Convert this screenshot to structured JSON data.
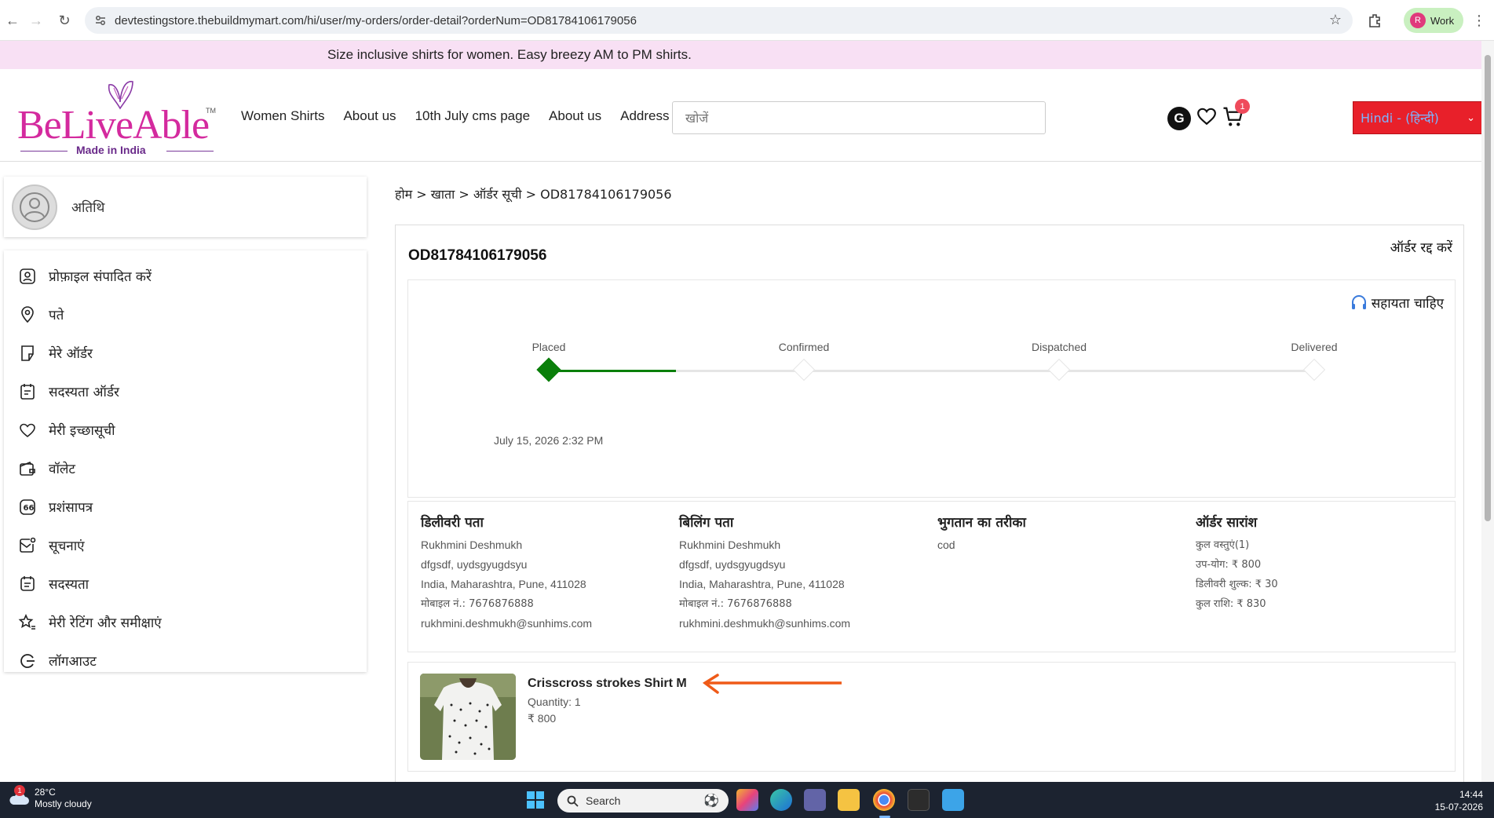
{
  "browser": {
    "url": "devtestingstore.thebuildmymart.com/hi/user/my-orders/order-detail?orderNum=OD81784106179056",
    "profile_initial": "R",
    "profile_label": "Work"
  },
  "promo": {
    "text": "Size inclusive shirts for women. Easy breezy AM to PM shirts."
  },
  "header": {
    "logo_word": "BeLiveAble",
    "logo_tm": "TM",
    "logo_tagline": "Made in India",
    "nav": [
      "Women Shirts",
      "About us",
      "10th July cms page",
      "About us",
      "Address"
    ],
    "search_placeholder": "खोजें",
    "account_initial": "G",
    "cart_count": "1",
    "language": "Hindi - (हिन्दी)"
  },
  "sidebar": {
    "user_name": "अतिथि",
    "items": [
      {
        "label": "प्रोफ़ाइल संपादित करें",
        "icon": "user-icon"
      },
      {
        "label": "पते",
        "icon": "location-pin-icon"
      },
      {
        "label": "मेरे ऑर्डर",
        "icon": "orders-icon"
      },
      {
        "label": "सदस्यता ऑर्डर",
        "icon": "subscription-order-icon"
      },
      {
        "label": "मेरी इच्छासूची",
        "icon": "heart-icon"
      },
      {
        "label": "वॉलेट",
        "icon": "wallet-icon"
      },
      {
        "label": "प्रशंसापत्र",
        "icon": "quote-icon"
      },
      {
        "label": "सूचनाएं",
        "icon": "notification-icon"
      },
      {
        "label": "सदस्यता",
        "icon": "membership-icon"
      },
      {
        "label": "मेरी रेटिंग और समीक्षाएं",
        "icon": "star-review-icon"
      },
      {
        "label": "लॉगआउट",
        "icon": "logout-icon"
      }
    ]
  },
  "breadcrumb": "होम > खाता > ऑर्डर सूची > OD81784106179056",
  "order": {
    "id": "OD81784106179056",
    "cancel_label": "ऑर्डर रद्द करें",
    "help_label": "सहायता चाहिए",
    "steps": [
      "Placed",
      "Confirmed",
      "Dispatched",
      "Delivered"
    ],
    "completed_steps": 1,
    "placed_date": "July 15, 2026 2:32 PM",
    "delivery": {
      "title": "डिलीवरी पता",
      "name": "Rukhmini Deshmukh",
      "line1": "dfgsdf, uydsgyugdsyu",
      "line2": "India, Maharashtra, Pune, 411028",
      "mobile": "मोबाइल नं.: 7676876888",
      "email": "rukhmini.deshmukh@sunhims.com"
    },
    "billing": {
      "title": "बिलिंग पता",
      "name": "Rukhmini Deshmukh",
      "line1": "dfgsdf, uydsgyugdsyu",
      "line2": "India, Maharashtra, Pune, 411028",
      "mobile": "मोबाइल नं.: 7676876888",
      "email": "rukhmini.deshmukh@sunhims.com"
    },
    "payment": {
      "title": "भुगतान का तरीका",
      "method": "cod"
    },
    "summary": {
      "title": "ऑर्डर सारांश",
      "items": "कुल वस्तुएं(1)",
      "subtotal": "उप-योग: ₹ 800",
      "delivery_fee": "डिलीवरी शुल्क: ₹ 30",
      "total": "कुल राशि: ₹ 830"
    },
    "item": {
      "name": "Crisscross strokes Shirt M",
      "quantity": "Quantity: 1",
      "price": "₹ 800"
    }
  },
  "taskbar": {
    "weather_badge": "1",
    "temperature": "28°C",
    "condition": "Mostly cloudy",
    "search_label": "Search",
    "time": "14:44",
    "date": "15-07-2026"
  },
  "colors": {
    "brand_pink": "#d42a9e",
    "success_green": "#0a7f0a",
    "lang_red": "#e8202a",
    "annotation_orange": "#ef5a18"
  }
}
